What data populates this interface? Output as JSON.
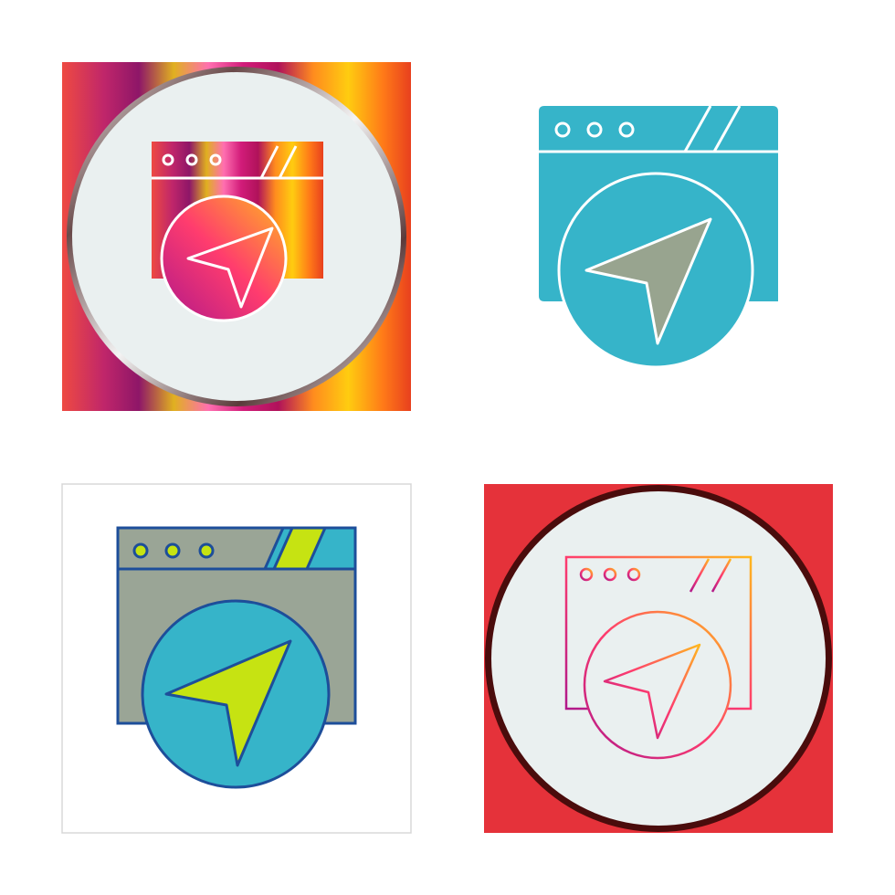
{
  "icons": [
    {
      "name": "browser-navigation-gradient-badge-icon",
      "style": "gradient-badge"
    },
    {
      "name": "browser-navigation-glyph-icon",
      "style": "glyph",
      "fill": "#36b4c9",
      "arrow": "#98a48f"
    },
    {
      "name": "browser-navigation-filled-outline-icon",
      "style": "filled-outline",
      "outline": "#1d4e9a",
      "window": "#9aa596",
      "circle": "#36b4c9",
      "arrow": "#c6e312"
    },
    {
      "name": "browser-navigation-gradient-line-badge-icon",
      "style": "gradient-line-badge",
      "badge": "#e5323a",
      "ring": "#4a0c0c"
    }
  ],
  "colors": {
    "disc": "#eaf0f0",
    "white": "#ffffff"
  }
}
